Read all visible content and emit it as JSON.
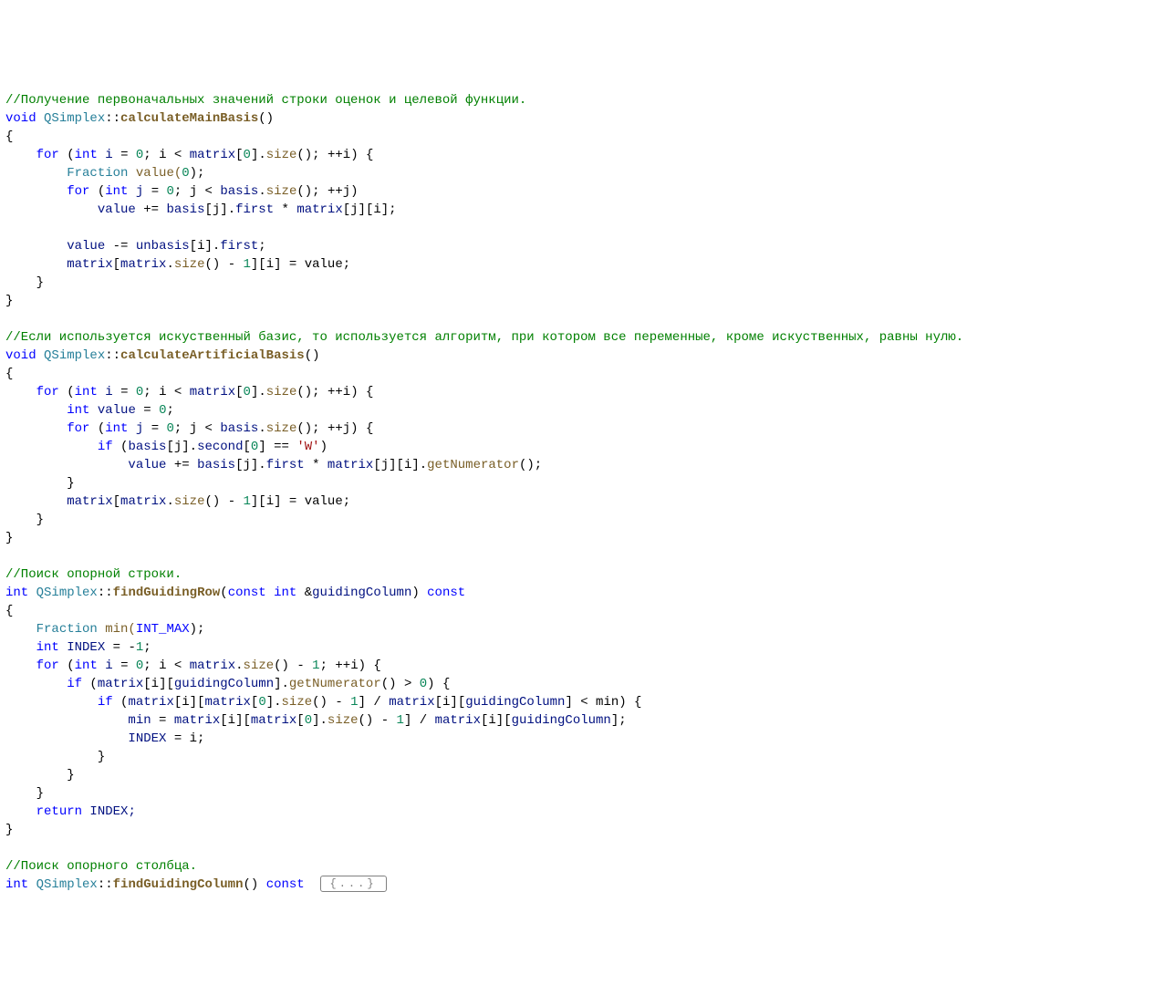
{
  "code": {
    "comment1": "//Получение первоначальных значений строки оценок и целевой функции.",
    "kw_void1": "void",
    "cls1": "QSimplex",
    "scope1": "::",
    "fn1": "calculateMainBasis",
    "paren1": "()",
    "brace_open1": "{",
    "for1_kw": "for",
    "for1_open": " (",
    "int1": "int",
    "i1": " i ",
    "eq1": "= ",
    "zero1": "0",
    "semi1": "; i ",
    "lt1": "< ",
    "matrix1": "matrix",
    "br1": "[",
    "zero2": "0",
    "br2": "].",
    "size1": "size",
    "call1": "(); ",
    "inc1": "++i) {",
    "frac1": "Fraction",
    "val1": " value(",
    "zero3": "0",
    "close1": ");",
    "for2_kw": "for",
    "for2_open": " (",
    "int2": "int",
    "j1": " j ",
    "eq2": "= ",
    "zero4": "0",
    "semi2": "; j ",
    "lt2": "< ",
    "basis1": "basis",
    "dot1": ".",
    "size2": "size",
    "call2": "(); ",
    "inc2": "++j)",
    "val2": "value ",
    "pluseq1": "+= ",
    "basis2": "basis",
    "brj1": "[j].",
    "first1": "first",
    "mult1": " * ",
    "matrix2": "matrix",
    "brj2": "[j][i];",
    "val3": "value ",
    "minuseq1": "-= ",
    "unbasis1": "unbasis",
    "bri1": "[i].",
    "first2": "first",
    "semi3": ";",
    "matrix3": "matrix",
    "brm1": "[",
    "matrix4": "matrix",
    "dot2": ".",
    "size3": "size",
    "call3": "() - ",
    "one1": "1",
    "brm2": "][i] ",
    "eq3": "= value;",
    "brace_close1a": "}",
    "brace_close1b": "}",
    "comment2": "//Если используется искуственный базис, то используется алгоритм, при котором все переменные, кроме искуственных, равны нулю.",
    "kw_void2": "void",
    "cls2": "QSimplex",
    "scope2": "::",
    "fn2": "calculateArtificialBasis",
    "paren2": "()",
    "brace_open2": "{",
    "for3_kw": "for",
    "for3_open": " (",
    "int3": "int",
    "i3": " i ",
    "eq4": "= ",
    "zero5": "0",
    "semi4": "; i ",
    "lt3": "< ",
    "matrix5": "matrix",
    "br3": "[",
    "zero6": "0",
    "br4": "].",
    "size4": "size",
    "call4": "(); ",
    "inc3": "++i) {",
    "int4": "int",
    "val4": " value ",
    "eq5": "= ",
    "zero7": "0",
    "semi5": ";",
    "for4_kw": "for",
    "for4_open": " (",
    "int5": "int",
    "j2": " j ",
    "eq6": "= ",
    "zero8": "0",
    "semi6": "; j ",
    "lt4": "< ",
    "basis3": "basis",
    "dot3": ".",
    "size5": "size",
    "call5": "(); ",
    "inc4": "++j) {",
    "if1_kw": "if",
    "if1_open": " (",
    "basis4": "basis",
    "brj3": "[j].",
    "second1": "second",
    "br5": "[",
    "zero9": "0",
    "br6": "] ",
    "eqeq1": "== ",
    "char1": "'W'",
    "close2": ")",
    "val5": "value ",
    "pluseq2": "+= ",
    "basis5": "basis",
    "brj4": "[j].",
    "first3": "first",
    "mult2": " * ",
    "matrix6": "matrix",
    "brj5": "[j][i].",
    "getnum1": "getNumerator",
    "call6": "();",
    "brace_close2a": "}",
    "matrix7": "matrix",
    "brm3": "[",
    "matrix8": "matrix",
    "dot4": ".",
    "size6": "size",
    "call7": "() - ",
    "one2": "1",
    "brm4": "][i] ",
    "eq7": "= value;",
    "brace_close2b": "}",
    "brace_close2c": "}",
    "comment3": "//Поиск опорной строки.",
    "int6": "int",
    "cls3": "QSimplex",
    "scope3": "::",
    "fn3": "findGuidingRow",
    "paren3a": "(",
    "const1": "const",
    "int7": " int ",
    "amp1": "&",
    "gc1": "guidingColumn",
    "paren3b": ") ",
    "const2": "const",
    "brace_open3": "{",
    "frac2": "Fraction",
    "min1": " min(",
    "intmax1": "INT_MAX",
    "close3": ");",
    "int8": "int",
    "idx1": " INDEX ",
    "eq8": "= ",
    "neg1": "-",
    "one3": "1",
    "semi7": ";",
    "for5_kw": "for",
    "for5_open": " (",
    "int9": "int",
    "i5": " i ",
    "eq9": "= ",
    "zero10": "0",
    "semi8": "; i ",
    "lt5": "< ",
    "matrix9": "matrix",
    "dot5": ".",
    "size7": "size",
    "call8": "() - ",
    "one4": "1",
    "semi9": "; ",
    "inc5": "++i) {",
    "if2_kw": "if",
    "if2_open": " (",
    "matrix10": "matrix",
    "bri2": "[i][",
    "gc2": "guidingColumn",
    "br7": "].",
    "getnum2": "getNumerator",
    "call9": "() ",
    "gt1": "> ",
    "zero11": "0",
    "close4": ") {",
    "if3_kw": "if",
    "if3_open": " (",
    "matrix11": "matrix",
    "bri3": "[i][",
    "matrix12": "matrix",
    "br8": "[",
    "zero12": "0",
    "br9": "].",
    "size8": "size",
    "call10": "() - ",
    "one5": "1",
    "br10": "] ",
    "div1": "/ ",
    "matrix13": "matrix",
    "bri4": "[i][",
    "gc3": "guidingColumn",
    "br11": "] ",
    "lt6": "< min) {",
    "min2": "min ",
    "eq10": "= ",
    "matrix14": "matrix",
    "bri5": "[i][",
    "matrix15": "matrix",
    "br12": "[",
    "zero13": "0",
    "br13": "].",
    "size9": "size",
    "call11": "() - ",
    "one6": "1",
    "br14": "] ",
    "div2": "/ ",
    "matrix16": "matrix",
    "bri6": "[i][",
    "gc4": "guidingColumn",
    "br15": "];",
    "idx2": "INDEX ",
    "eq11": "= i;",
    "brace_close3a": "}",
    "brace_close3b": "}",
    "brace_close3c": "}",
    "return1": "return",
    "idx3": " INDEX;",
    "brace_close3d": "}",
    "comment4": "//Поиск опорного столбца.",
    "int10": "int",
    "cls4": "QSimplex",
    "scope4": "::",
    "fn4": "findGuidingColumn",
    "paren4": "() ",
    "const3": "const",
    "fold1": "{...}"
  }
}
